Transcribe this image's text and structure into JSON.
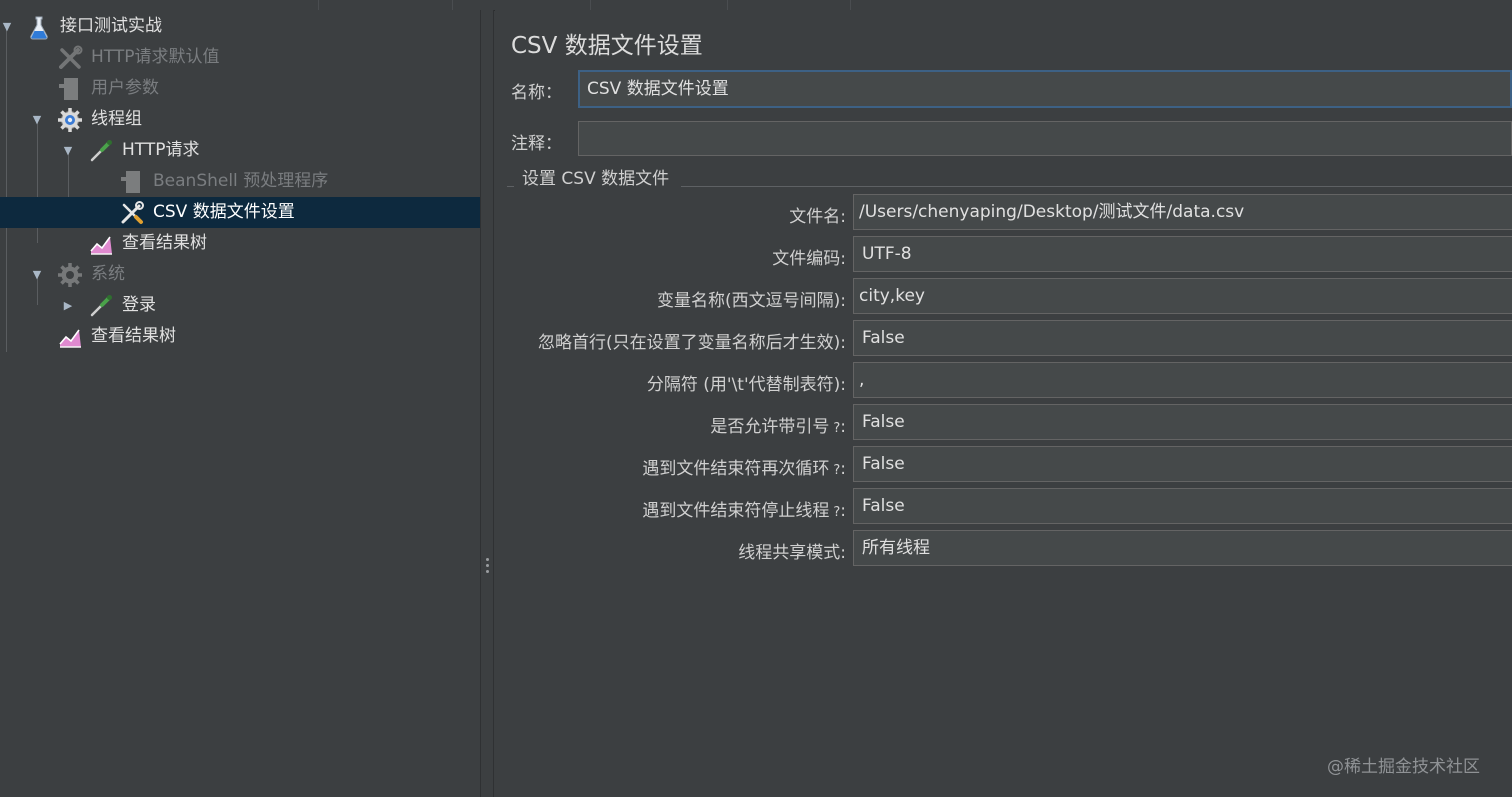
{
  "tree": {
    "items": [
      {
        "label": "接口测试实战",
        "icon": "test-plan-flask-icon",
        "expanded": true,
        "disabled": false
      },
      {
        "label": "HTTP请求默认值",
        "icon": "config-wrench-icon",
        "disabled": true
      },
      {
        "label": "用户参数",
        "icon": "preprocessor-doc-icon",
        "disabled": true
      },
      {
        "label": "线程组",
        "icon": "thread-group-gear-icon",
        "expanded": true,
        "disabled": false
      },
      {
        "label": "HTTP请求",
        "icon": "sampler-pipette-icon",
        "expanded": true,
        "disabled": false
      },
      {
        "label": "BeanShell 预处理程序",
        "icon": "preprocessor-doc-icon",
        "disabled": true
      },
      {
        "label": "CSV 数据文件设置",
        "icon": "config-wrench-icon",
        "selected": true,
        "disabled": false
      },
      {
        "label": "查看结果树",
        "icon": "listener-graph-icon",
        "disabled": false
      },
      {
        "label": "系统",
        "icon": "thread-group-gear-icon",
        "expanded": true,
        "disabled": true
      },
      {
        "label": "登录",
        "icon": "sampler-pipette-icon",
        "expanded": false,
        "disabled": false
      },
      {
        "label": "查看结果树",
        "icon": "listener-graph-icon",
        "disabled": false
      }
    ]
  },
  "panel": {
    "title": "CSV 数据文件设置",
    "name_label": "名称：",
    "name_value": "CSV 数据文件设置",
    "comment_label": "注释：",
    "comment_value": "",
    "group_title": "设置 CSV 数据文件",
    "fields": [
      {
        "label": "文件名:",
        "value": "/Users/chenyaping/Desktop/测试文件/data.csv"
      },
      {
        "label": "文件编码:",
        "value": "UTF-8"
      },
      {
        "label": "变量名称(西文逗号间隔):",
        "value": "city,key"
      },
      {
        "label": "忽略首行(只在设置了变量名称后才生效):",
        "value": "False"
      },
      {
        "label": "分隔符 (用'\\t'代替制表符):",
        "value": ","
      },
      {
        "label": "是否允许带引号",
        "help": "?",
        "colon": ":",
        "value": "False"
      },
      {
        "label": "遇到文件结束符再次循环",
        "help": "?",
        "colon": ":",
        "value": "False"
      },
      {
        "label": "遇到文件结束符停止线程",
        "help": "?",
        "colon": ":",
        "value": "False"
      },
      {
        "label": "线程共享模式:",
        "value": "所有线程"
      }
    ]
  },
  "watermark": "@稀土掘金技术社区",
  "colors": {
    "background": "#3c3f41",
    "selection": "#0d293e",
    "field": "#45494a",
    "focus_border": "#3d6185"
  }
}
